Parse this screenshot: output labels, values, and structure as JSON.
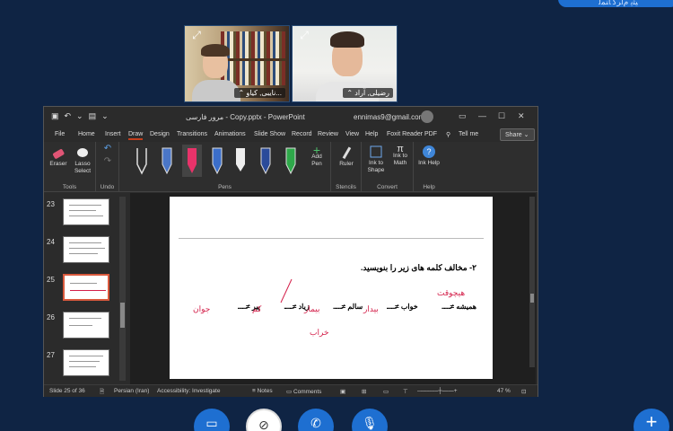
{
  "top_badge": "ﯿﺜﻳ ﻡﺍﺮﮔ ﺎﻨﻤﻟ",
  "participants": [
    {
      "name": "نایبی, کیاو...",
      "expand_icon": "expand-icon"
    },
    {
      "name": "رضیلی, آراد",
      "expand_icon": "expand-icon"
    }
  ],
  "powerpoint": {
    "file_title": "مرور فارسی - Copy.pptx - PowerPoint",
    "account_email": "ennimas9@gmail.com",
    "account_initial": "",
    "menu_tabs": [
      "File",
      "Home",
      "Insert",
      "Draw",
      "Design",
      "Transitions",
      "Animations",
      "Slide Show",
      "Record",
      "Review",
      "View",
      "Help",
      "Foxit Reader PDF",
      "Tell me",
      "Share"
    ],
    "active_tab": "Draw",
    "ribbon": {
      "tools": {
        "eraser": "Eraser",
        "lasso": "Lasso Select",
        "group": "Tools"
      },
      "undo": {
        "group": "Undo"
      },
      "pens": {
        "group": "Pens",
        "add_pen": "Add Pen"
      },
      "stencils": {
        "ruler": "Ruler",
        "group": "Stencils"
      },
      "convert": {
        "ink_to_shape": "Ink to Shape",
        "ink_to_math": "Ink to Math",
        "group": "Convert"
      },
      "help": {
        "ink_help": "Ink Help",
        "group": "Help"
      }
    },
    "slide_numbers": [
      "23",
      "24",
      "25",
      "26",
      "27"
    ],
    "selected_slide": "25",
    "slide": {
      "question": "۲- مخالف کلمه های زیر را بنویسید.",
      "pairs": [
        {
          "word": "همیشه ≠",
          "answer": "هیچوقت"
        },
        {
          "word": "خواب ≠",
          "answer": "بیدار"
        },
        {
          "word": "سالم ≠",
          "answer": "بیمار"
        },
        {
          "word": "زیاد ≠",
          "answer": "کم"
        },
        {
          "word": "پیر ≠",
          "answer": "جوان"
        }
      ],
      "extra_ink": "خراب"
    },
    "status": {
      "slide_counter": "Slide 25 of 36",
      "language": "Persian (Iran)",
      "accessibility": "Accessibility: Investigate",
      "notes": "Notes",
      "comments": "Comments",
      "zoom": "47 %"
    }
  },
  "meeting_controls": [
    "screen-share-icon",
    "camera-off-icon",
    "phone-icon",
    "microphone-icon"
  ],
  "fab": "+"
}
